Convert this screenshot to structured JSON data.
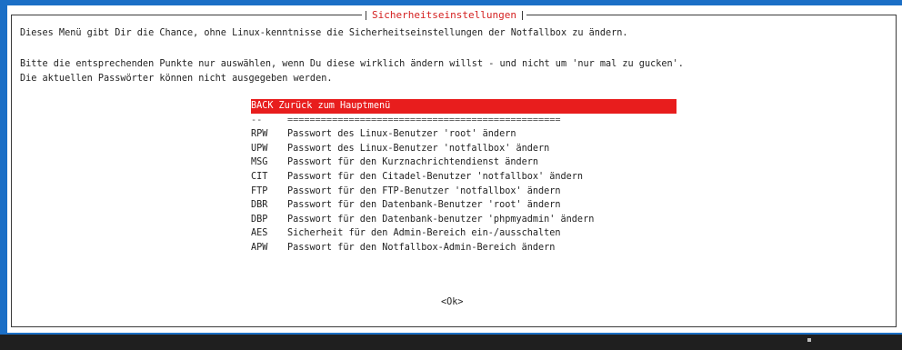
{
  "dialog": {
    "title": "Sicherheitseinstellungen",
    "line1": "Dieses Menü gibt Dir die Chance, ohne Linux-kenntnisse die Sicherheitseinstellungen der Notfallbox zu ändern.",
    "line2": "Bitte die entsprechenden Punkte nur auswählen, wenn Du diese wirklich ändern willst - und nicht um 'nur mal zu gucken'.",
    "line3": "Die aktuellen Passwörter können nicht ausgegeben werden."
  },
  "menu": {
    "selected": {
      "tag": "BACK",
      "label": "Zurück zum Hauptmenü"
    },
    "separator": {
      "tag": "--",
      "label": "================================================="
    },
    "items": [
      {
        "tag": "RPW",
        "label": "Passwort des Linux-Benutzer 'root' ändern"
      },
      {
        "tag": "UPW",
        "label": "Passwort des Linux-Benutzer 'notfallbox' ändern"
      },
      {
        "tag": "MSG",
        "label": "Passwort für den Kurznachrichtendienst ändern"
      },
      {
        "tag": "CIT",
        "label": "Passwort für den Citadel-Benutzer 'notfallbox' ändern"
      },
      {
        "tag": "FTP",
        "label": "Passwort für den FTP-Benutzer 'notfallbox' ändern"
      },
      {
        "tag": "DBR",
        "label": "Passwort für den Datenbank-Benutzer 'root' ändern"
      },
      {
        "tag": "DBP",
        "label": "Passwort für den Datenbank-benutzer 'phpmyadmin' ändern"
      },
      {
        "tag": "AES",
        "label": "Sicherheit für den Admin-Bereich ein-/ausschalten"
      },
      {
        "tag": "APW",
        "label": "Passwort für den Notfallbox-Admin-Bereich ändern"
      }
    ]
  },
  "buttons": {
    "ok": "<Ok>"
  },
  "colors": {
    "background": "#1b6fc6",
    "title": "#d42020",
    "highlight": "#e81d1d"
  }
}
